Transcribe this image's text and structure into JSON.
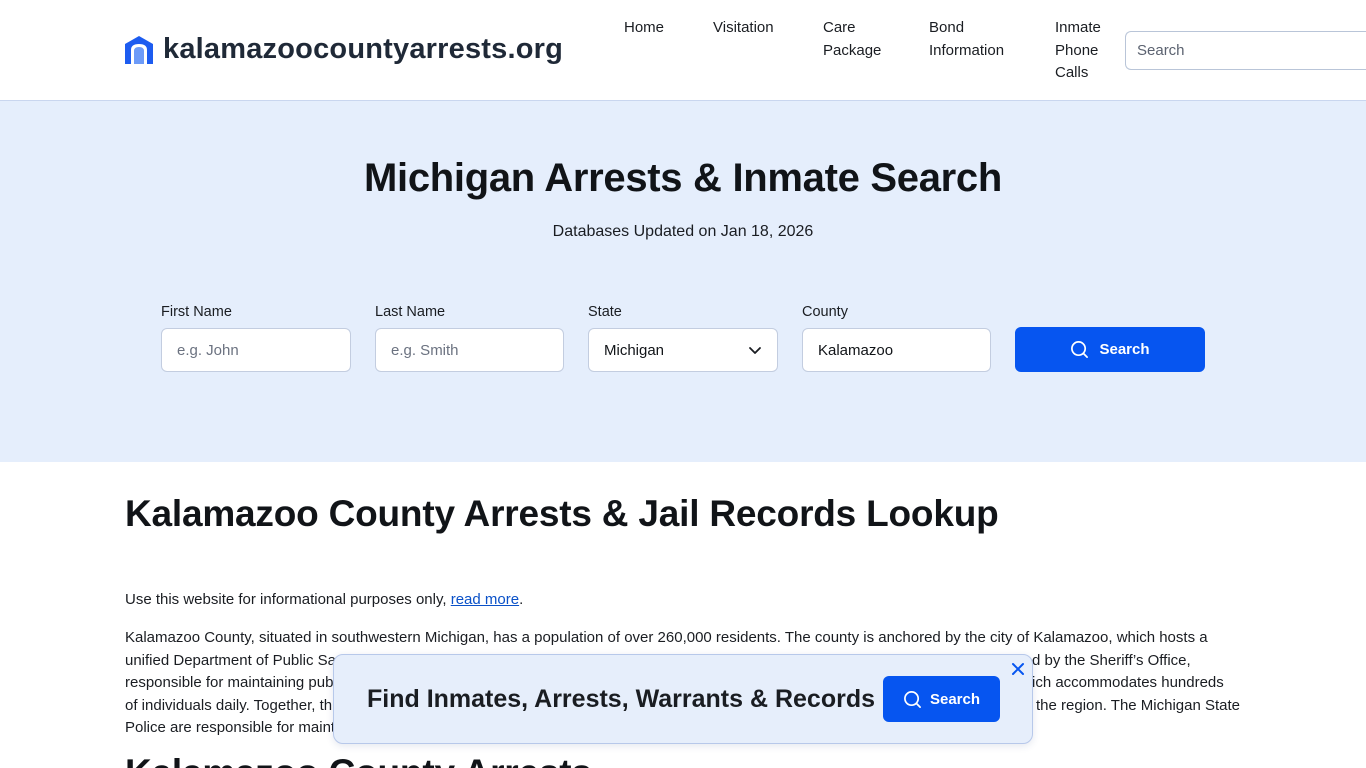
{
  "header": {
    "site_name": "kalamazoocountyarrests.org",
    "nav": [
      {
        "label": "Home"
      },
      {
        "label": "Visitation"
      },
      {
        "label": "Care Package"
      },
      {
        "label": "Bond Information"
      },
      {
        "label": "Inmate Phone Calls"
      }
    ],
    "search_placeholder": "Search",
    "logo_icon": "house-shield-icon"
  },
  "hero": {
    "title": "Michigan Arrests & Inmate Search",
    "subtitle": "Databases Updated on Jan 18, 2026",
    "form": {
      "first_name_label": "First Name",
      "first_name_placeholder": "e.g. John",
      "last_name_label": "Last Name",
      "last_name_placeholder": "e.g. Smith",
      "state_label": "State",
      "state_value": "Michigan",
      "county_label": "County",
      "county_value": "Kalamazoo",
      "search_button": "Search"
    }
  },
  "content": {
    "heading": "Kalamazoo County Arrests & Jail Records Lookup",
    "disclaimer_text": "Use this website for informational purposes only, ",
    "disclaimer_link": "read more",
    "disclaimer_end": ".",
    "paragraph_lines": [
      "Kalamazoo County, situated in southwestern Michigan, has a population of over 260,000 residents. The county is anchored by the city of Kalamazoo, which hosts a",
      "unified Department of Public Sa",
      "responsible for maintaining pub",
      "of individuals daily. Together, th",
      "Police are responsible for maint"
    ],
    "paragraph_right_fragments": [
      "",
      "d by the Sheriff’s Office,",
      "ich accommodates hundreds",
      "the region. The Michigan State",
      ""
    ],
    "next_heading": "Kalamazoo County Arrests"
  },
  "popup": {
    "text": "Find Inmates, Arrests, Warrants & Records",
    "button": "Search"
  },
  "colors": {
    "primary": "#0655f0",
    "hero_bg": "#e5eefc",
    "popup_bg": "#e6eefb",
    "link": "#0a51c8"
  }
}
